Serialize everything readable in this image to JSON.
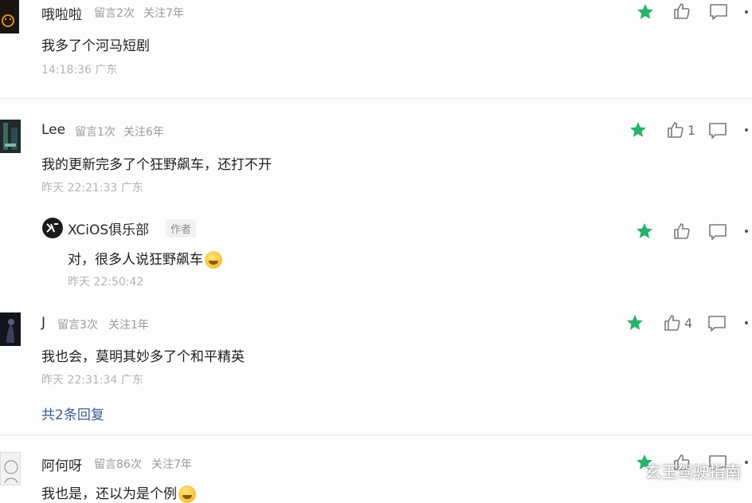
{
  "comments": [
    {
      "username": "哦啦啦",
      "messages": "留言2次",
      "follow": "关注7年",
      "content": "我多了个河马短剧",
      "time": "14:18:36 广东",
      "likes": ""
    },
    {
      "username": "Lee",
      "messages": "留言1次",
      "follow": "关注6年",
      "content": "我的更新完多了个狂野飙车，还打不开",
      "time": "昨天 22:21:33 广东",
      "likes": "1",
      "reply": {
        "author": "XCiOS俱乐部",
        "badge": "作者",
        "content": "对，很多人说狂野飙车",
        "time": "昨天 22:50:42"
      }
    },
    {
      "username": "J",
      "messages": "留言3次",
      "follow": "关注1年",
      "content": "我也会，莫明其妙多了个和平精英",
      "time": "昨天 22:31:34 广东",
      "likes": "4",
      "more_replies": "共2条回复"
    },
    {
      "username": "阿何呀",
      "messages": "留言86次",
      "follow": "关注7年",
      "content": "我也是，还以为是个例",
      "likes": ""
    }
  ],
  "watermark": "玄玉驾驶指南",
  "colors": {
    "star": "#27b36a",
    "link": "#3b5e8f",
    "meta": "#9a9a9a"
  },
  "icons": [
    "star-icon",
    "thumbs-up-icon",
    "comment-icon",
    "more-icon"
  ]
}
